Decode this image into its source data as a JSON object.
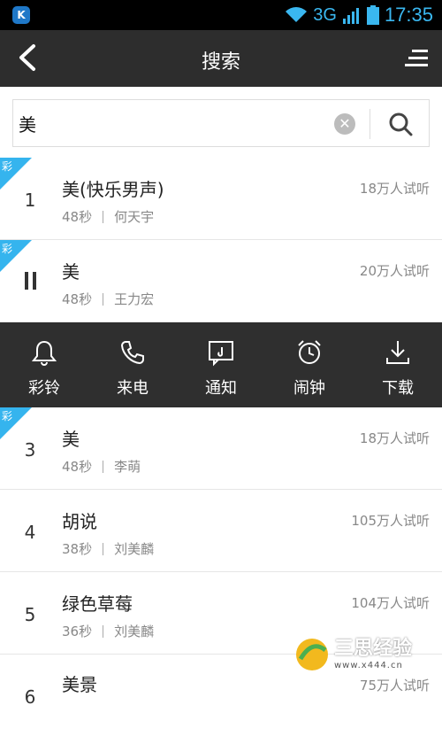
{
  "status": {
    "network": "3G",
    "time": "17:35"
  },
  "header": {
    "title": "搜索"
  },
  "search": {
    "value": "美"
  },
  "results": [
    {
      "rank": "1",
      "title": "美(快乐男声)",
      "duration": "48秒",
      "artist": "何天宇",
      "plays": "18万人试听",
      "badge": "彩"
    },
    {
      "rank": "",
      "title": "美",
      "duration": "48秒",
      "artist": "王力宏",
      "plays": "20万人试听",
      "badge": "彩",
      "state": "paused"
    },
    {
      "rank": "3",
      "title": "美",
      "duration": "48秒",
      "artist": "李萌",
      "plays": "18万人试听",
      "badge": "彩"
    },
    {
      "rank": "4",
      "title": "胡说",
      "duration": "38秒",
      "artist": "刘美麟",
      "plays": "105万人试听"
    },
    {
      "rank": "5",
      "title": "绿色草莓",
      "duration": "36秒",
      "artist": "刘美麟",
      "plays": "104万人试听"
    },
    {
      "rank": "6",
      "title": "美景",
      "duration": "",
      "artist": "",
      "plays": "75万人试听"
    }
  ],
  "actions": [
    {
      "label": "彩铃",
      "icon": "bell-icon"
    },
    {
      "label": "来电",
      "icon": "phone-icon"
    },
    {
      "label": "通知",
      "icon": "notification-icon"
    },
    {
      "label": "闹钟",
      "icon": "alarm-icon"
    },
    {
      "label": "下载",
      "icon": "download-icon"
    }
  ],
  "watermark": {
    "text": "三思经验",
    "url": "www.x444.cn"
  },
  "colors": {
    "accent": "#3ab7f0",
    "header_bg": "#2d2d2d",
    "action_bg": "#2f2f2f"
  }
}
